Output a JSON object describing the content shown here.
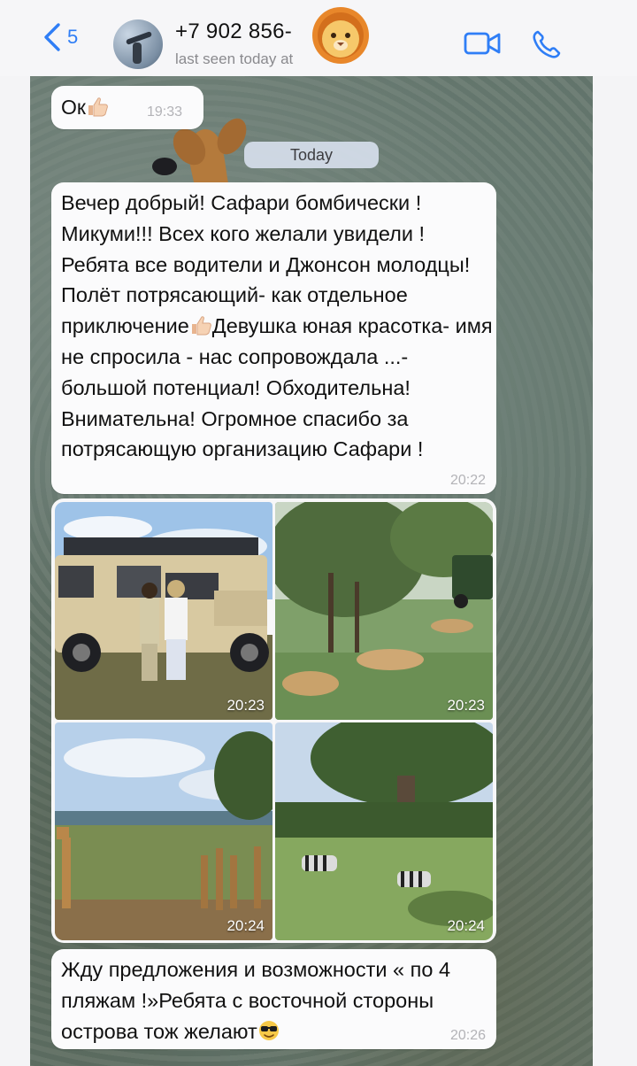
{
  "header": {
    "back_count": "5",
    "title": "+7 902 856-",
    "subtitle": "last seen today at"
  },
  "chat": {
    "date_separator": "Today",
    "messages": [
      {
        "text": "Ок",
        "emoji": "thumbs-up",
        "time": "19:33"
      },
      {
        "text_parts": [
          "Вечер добрый! Сафари бомбически ! Микуми!!! Всех кого желали увидели ! Ребята все водители и Джонсон молодцы! Полёт потрясающий- как отдельное приключение",
          "Девушка юная красотка- имя не спросила - нас сопровождала ...- большой потенциал! Обходительна! Внимательна! Огромное спасибо за потрясающую организацию Сафари !"
        ],
        "time": "20:22"
      },
      {
        "photos": [
          {
            "subject": "safari-jeep-people",
            "time": "20:23"
          },
          {
            "subject": "lions-under-tree",
            "time": "20:23"
          },
          {
            "subject": "giraffes-savanna",
            "time": "20:24"
          },
          {
            "subject": "zebras-baobab",
            "time": "20:24"
          }
        ]
      },
      {
        "text": "Жду предложения и возможности « по 4 пляжам !»Ребята с восточной стороны острова тож желают",
        "emoji": "sunglasses-face",
        "time": "20:26"
      }
    ]
  },
  "colors": {
    "accent": "#2f7ef6",
    "bubble": "#fbfbfc",
    "timestamp": "#b3b3b7"
  },
  "icons": [
    "chevron-left-icon",
    "video-call-icon",
    "phone-call-icon",
    "lion-emoji",
    "thumbs-up-emoji",
    "sunglasses-emoji"
  ]
}
